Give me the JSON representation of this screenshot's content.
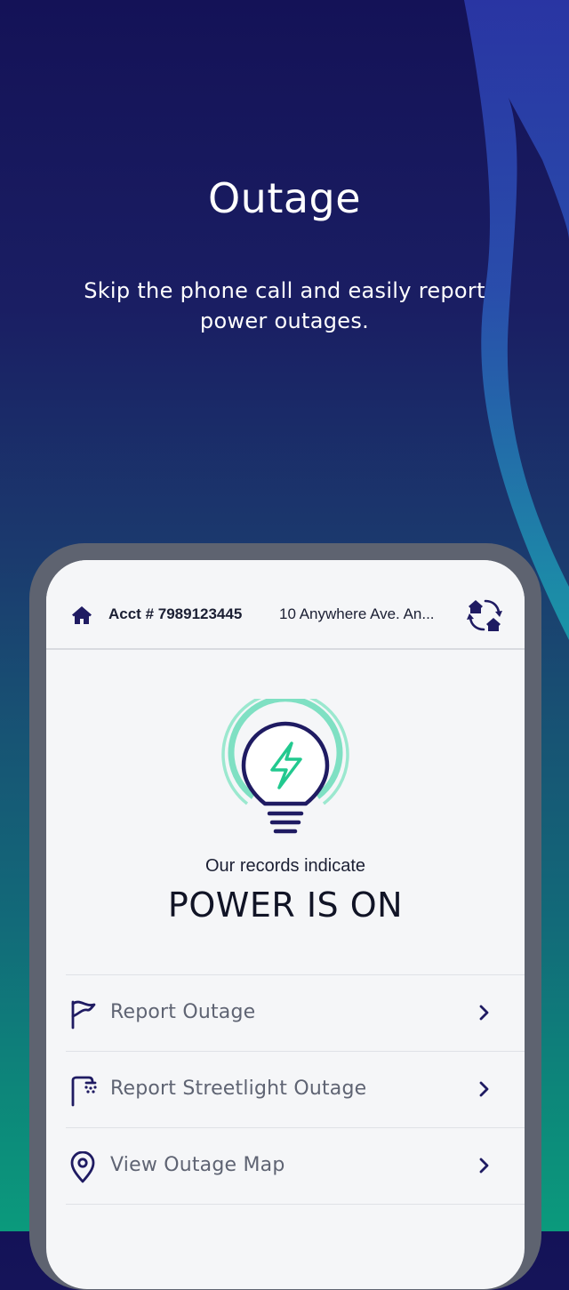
{
  "promo": {
    "title": "Outage",
    "subtitle": "Skip the phone call and easily report power outages."
  },
  "account": {
    "home_icon": "home-icon",
    "number": "Acct # 7989123445",
    "address": "10 Anywhere Ave. An...",
    "switch_icon": "switch-account-icon"
  },
  "status": {
    "icon": "lightbulb-bolt-icon",
    "records_text": "Our records indicate",
    "power_text": "POWER IS ON"
  },
  "menu": {
    "items": [
      {
        "label": "Report Outage",
        "icon": "flag-icon"
      },
      {
        "label": "Report Streetlight Outage",
        "icon": "streetlight-icon"
      },
      {
        "label": "View Outage Map",
        "icon": "map-pin-icon"
      }
    ]
  },
  "colors": {
    "navy": "#1f1b62",
    "accent_green": "#22c98f",
    "background_top": "#141257",
    "background_bottom": "#0b9a7c"
  }
}
